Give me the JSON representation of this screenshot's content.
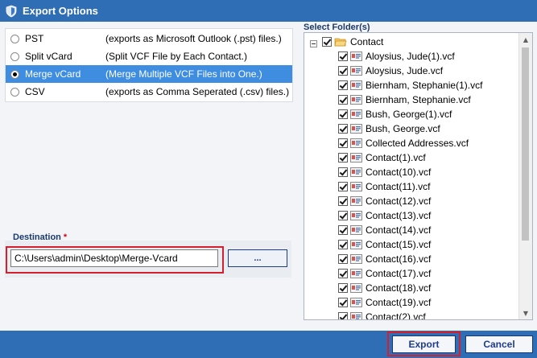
{
  "window": {
    "title": "Export Options"
  },
  "options": [
    {
      "name": "PST",
      "desc": "(exports as Microsoft Outlook (.pst) files.)",
      "selected": false
    },
    {
      "name": "Split vCard",
      "desc": "(Split VCF File by Each Contact.)",
      "selected": false
    },
    {
      "name": "Merge vCard",
      "desc": "(Merge Multiple VCF Files into One.)",
      "selected": true
    },
    {
      "name": "CSV",
      "desc": "(exports as Comma Seperated (.csv) files.)",
      "selected": false
    }
  ],
  "destination": {
    "label": "Destination",
    "required_mark": "*",
    "path": "C:\\Users\\admin\\Desktop\\Merge-Vcard",
    "browse_label": "..."
  },
  "folders": {
    "label": "Select Folder(s)",
    "root": "Contact",
    "items": [
      "Aloysius, Jude(1).vcf",
      "Aloysius, Jude.vcf",
      "Biernham, Stephanie(1).vcf",
      "Biernham, Stephanie.vcf",
      "Bush, George(1).vcf",
      "Bush, George.vcf",
      "Collected Addresses.vcf",
      "Contact(1).vcf",
      "Contact(10).vcf",
      "Contact(11).vcf",
      "Contact(12).vcf",
      "Contact(13).vcf",
      "Contact(14).vcf",
      "Contact(15).vcf",
      "Contact(16).vcf",
      "Contact(17).vcf",
      "Contact(18).vcf",
      "Contact(19).vcf",
      "Contact(2).vcf"
    ]
  },
  "buttons": {
    "export": "Export",
    "cancel": "Cancel"
  },
  "colors": {
    "titlebar": "#2f6db5",
    "selected_row": "#3f8de0",
    "highlight": "#d32030"
  }
}
